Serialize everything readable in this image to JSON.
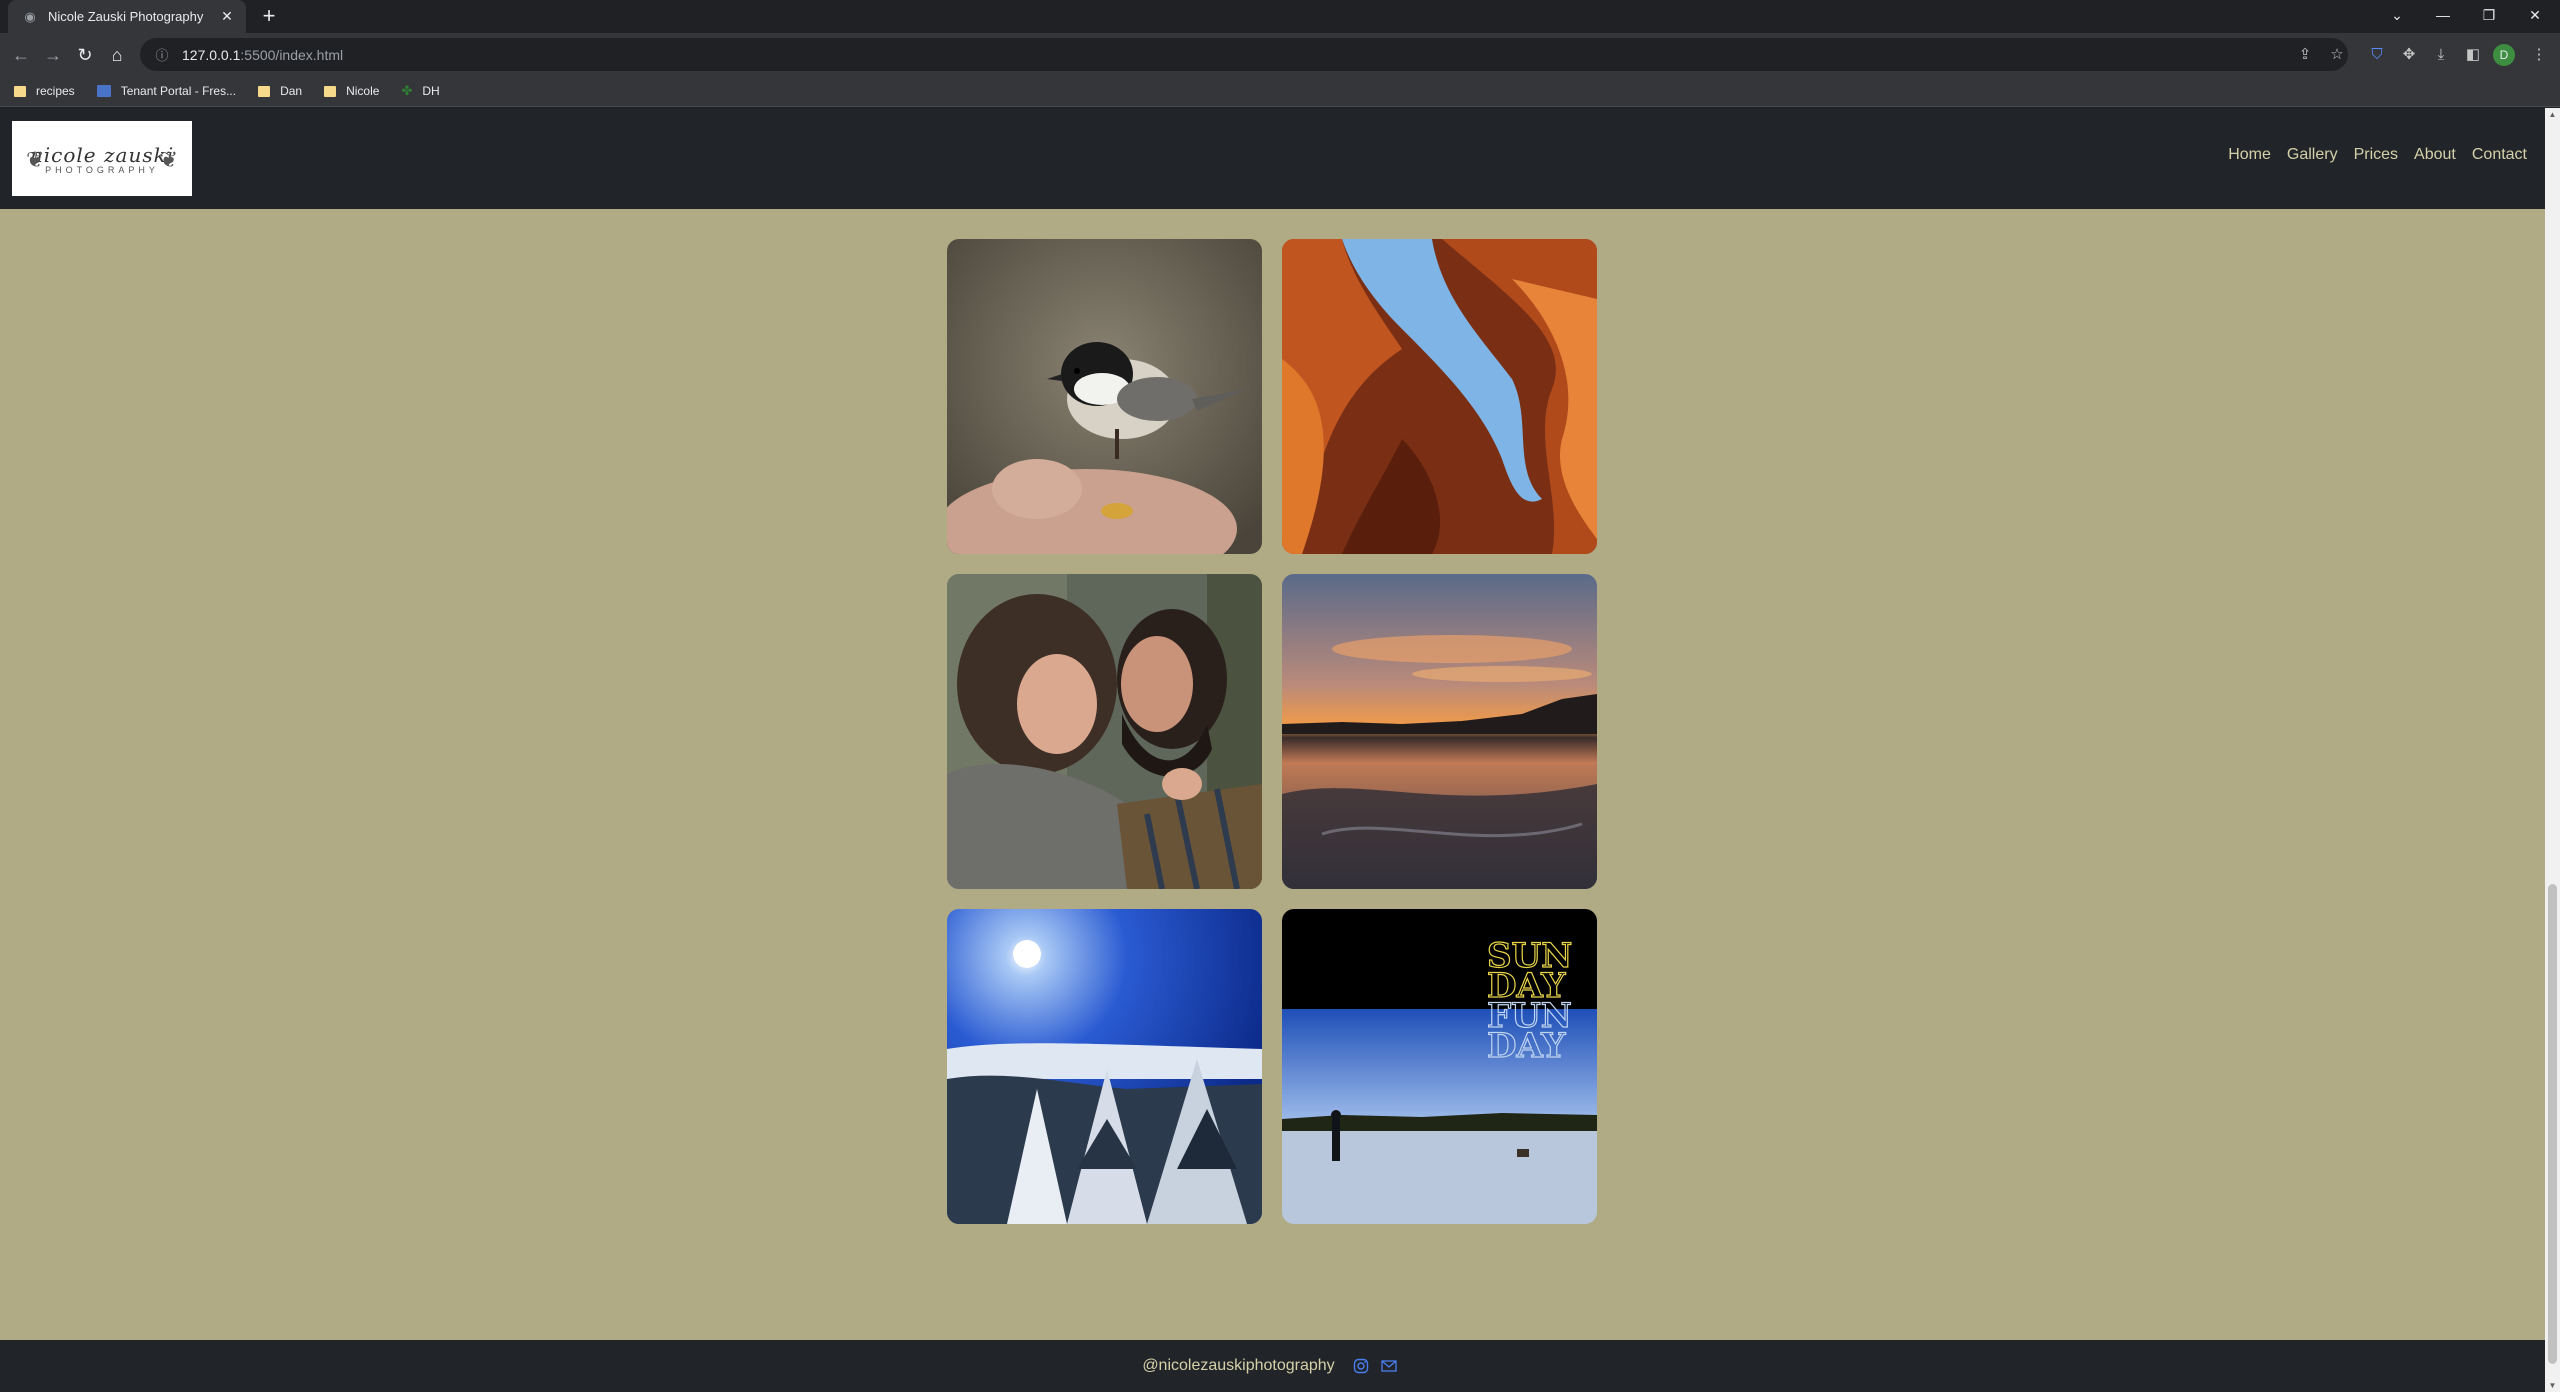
{
  "browser": {
    "tab_title": "Nicole Zauski Photography",
    "url_host": "127.0.0.1",
    "url_path": ":5500/index.html",
    "profile_initial": "D",
    "bookmarks": [
      {
        "label": "recipes",
        "kind": "folder"
      },
      {
        "label": "Tenant Portal - Fres...",
        "kind": "site"
      },
      {
        "label": "Dan",
        "kind": "folder"
      },
      {
        "label": "Nicole",
        "kind": "folder"
      },
      {
        "label": "DH",
        "kind": "leaf"
      }
    ]
  },
  "site": {
    "logo_script": "nicole zauski",
    "logo_sub": "PHOTOGRAPHY",
    "nav": [
      "Home",
      "Gallery",
      "Prices",
      "About",
      "Contact"
    ],
    "photo_overlay": [
      "SUN",
      "DAY",
      "FUN",
      "DAY"
    ],
    "footer_handle": "@nicolezauskiphotography"
  }
}
